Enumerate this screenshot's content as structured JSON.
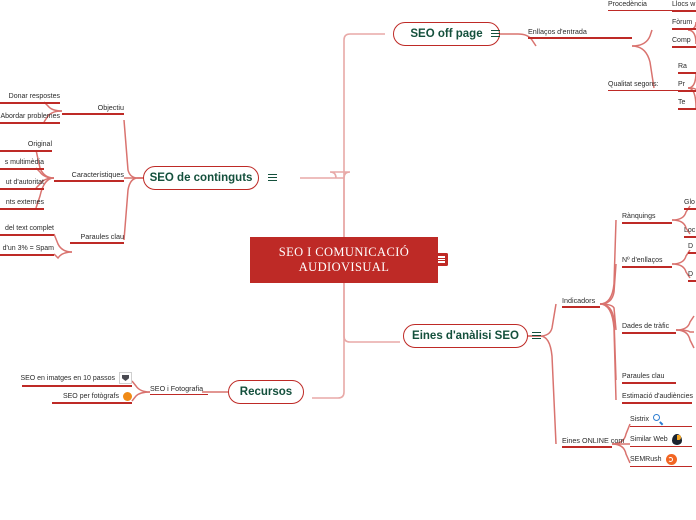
{
  "mindmap": {
    "root": {
      "text": "SEO I COMUNICACIÓ\nAUDIOVISUAL",
      "color": "#BE2A26",
      "note_icon": "hamburger-icon"
    },
    "branch_color": "#BE2A26",
    "branch_label_color": "#14503C",
    "branches": [
      {
        "id": "seo-off-page",
        "label": "SEO off page",
        "note_icon": "hamburger-icon",
        "children": [
          {
            "label": "Enllaços d'entrada",
            "children": [
              {
                "label": "Procedència",
                "children": [
                  {
                    "label": "Llocs w"
                  },
                  {
                    "label": "Fòrum"
                  },
                  {
                    "label": "Comp"
                  }
                ]
              },
              {
                "label": "Qualitat segons:",
                "children": [
                  {
                    "label": "Ra"
                  },
                  {
                    "label": "Pr"
                  },
                  {
                    "label": "Te"
                  }
                ]
              }
            ]
          }
        ]
      },
      {
        "id": "seo-de-continguts",
        "label": "SEO de continguts",
        "note_icon": "hamburger-icon",
        "children": [
          {
            "label": "Objectiu",
            "children": [
              {
                "label": "Donar respostes"
              },
              {
                "label": "Abordar problemes"
              }
            ]
          },
          {
            "label": "Característiques",
            "children": [
              {
                "label": "Original"
              },
              {
                "label": "s multimèdia"
              },
              {
                "label": "ut d'autoritat"
              },
              {
                "label": "nts externes"
              }
            ]
          },
          {
            "label": "Paraules clau",
            "children": [
              {
                "label": "del text complet"
              },
              {
                "label": "d'un 3% = Spam"
              }
            ]
          }
        ]
      },
      {
        "id": "eines-danalisi-seo",
        "label": "Eines d'anàlisi SEO",
        "note_icon": "hamburger-icon",
        "children": [
          {
            "label": "Indicadors",
            "children": [
              {
                "label": "Rànquings",
                "children": [
                  {
                    "label": "Glo"
                  },
                  {
                    "label": "Loc"
                  }
                ]
              },
              {
                "label": "Nº d'enllaços",
                "children": [
                  {
                    "label": "D"
                  },
                  {
                    "label": "D"
                  }
                ]
              },
              {
                "label": "Dades de tràfic"
              },
              {
                "label": "Paraules clau"
              },
              {
                "label": "Estimació d'audiències"
              }
            ]
          },
          {
            "label": "Eines ONLINE com",
            "children": [
              {
                "label": "Sistrix",
                "icon": "magnifier-icon"
              },
              {
                "label": "Similar Web",
                "icon": "similarweb-icon"
              },
              {
                "label": "SEMRush",
                "icon": "semrush-icon"
              }
            ]
          }
        ]
      },
      {
        "id": "recursos",
        "label": "Recursos",
        "children": [
          {
            "label": "SEO i Fotografia",
            "children": [
              {
                "label": "SEO en imatges en 10 passos",
                "icon": "badge-icon"
              },
              {
                "label": "SEO per fotògrafs",
                "icon": "orange-dot-icon"
              }
            ]
          }
        ]
      }
    ]
  }
}
